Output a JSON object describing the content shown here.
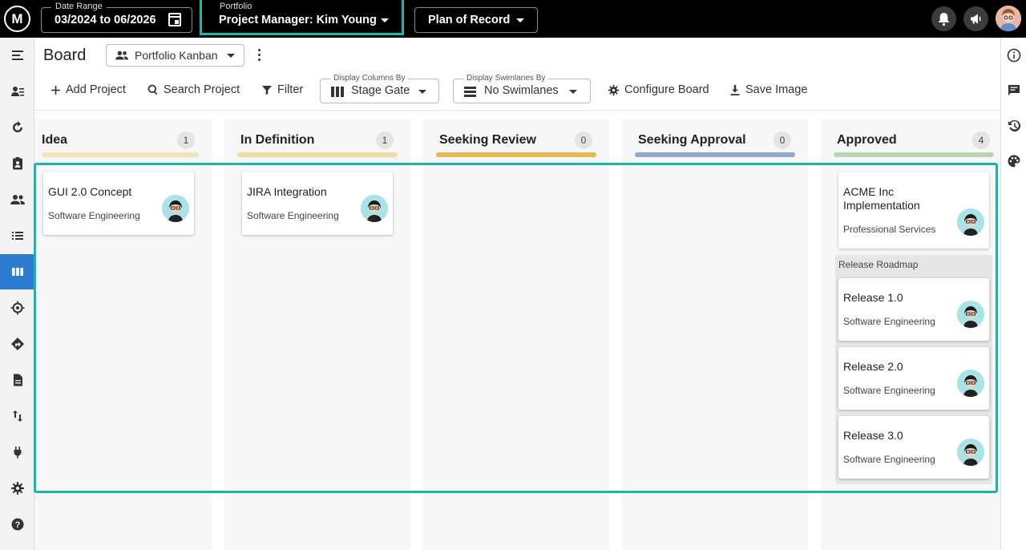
{
  "app": {
    "logo_text": "M"
  },
  "topbar": {
    "date_range": {
      "label": "Date Range",
      "value": "03/2024 to 06/2026"
    },
    "portfolio": {
      "label": "Portfolio",
      "value": "Project Manager: Kim Young"
    },
    "plan": {
      "value": "Plan of Record"
    },
    "accent_color": "#18b7ae"
  },
  "leftnav": {
    "items": [
      "menu-icon",
      "user-list-icon",
      "refresh-icon",
      "clipboard-user-icon",
      "people-icon",
      "list-icon",
      "board-icon",
      "target-icon",
      "directions-icon",
      "document-icon",
      "transfer-icon",
      "plug-icon",
      "gear-icon",
      "help-icon"
    ],
    "active": "board-icon",
    "active_color": "#2b7bd1"
  },
  "rightrail": {
    "items": [
      "info-icon",
      "comment-icon",
      "history-icon",
      "palette-icon"
    ]
  },
  "header": {
    "title": "Board",
    "view": "Portfolio Kanban"
  },
  "toolbar": {
    "add_project": "Add Project",
    "search_project": "Search Project",
    "filter": "Filter",
    "columns_by": {
      "label": "Display Columns By",
      "value": "Stage Gate"
    },
    "swimlanes_by": {
      "label": "Display Swimlanes By",
      "value": "No Swimlanes"
    },
    "configure_board": "Configure Board",
    "save_image": "Save Image"
  },
  "columns": [
    {
      "title": "Idea",
      "count": "1",
      "color": "#f3e3b8"
    },
    {
      "title": "In Definition",
      "count": "1",
      "color": "#f1dca6"
    },
    {
      "title": "Seeking Review",
      "count": "0",
      "color": "#e4b95b"
    },
    {
      "title": "Seeking Approval",
      "count": "0",
      "color": "#8fa9cf"
    },
    {
      "title": "Approved",
      "count": "4",
      "color": "#b9d5b2"
    }
  ],
  "cards": {
    "idea": [
      {
        "title": "GUI 2.0 Concept",
        "subtitle": "Software Engineering"
      }
    ],
    "in_definition": [
      {
        "title": "JIRA Integration",
        "subtitle": "Software Engineering"
      }
    ],
    "approved": [
      {
        "title": "ACME Inc Implementation",
        "subtitle": "Professional Services"
      }
    ],
    "release_group": {
      "label": "Release Roadmap",
      "items": [
        {
          "title": "Release 1.0",
          "subtitle": "Software Engineering"
        },
        {
          "title": "Release 2.0",
          "subtitle": "Software Engineering"
        },
        {
          "title": "Release 3.0",
          "subtitle": "Software Engineering"
        }
      ]
    }
  }
}
